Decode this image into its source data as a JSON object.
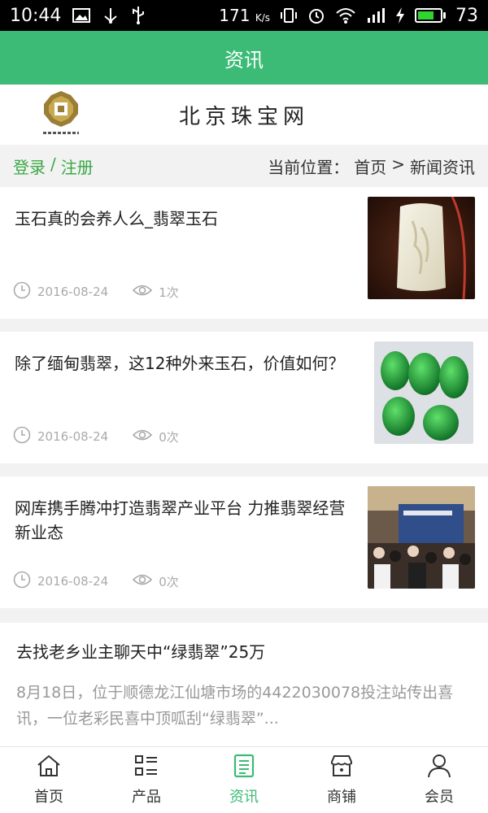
{
  "status_bar": {
    "time": "10:44",
    "net_speed": "171",
    "net_unit": "K/s",
    "battery": "73",
    "battery_fraction": 0.73,
    "icons": [
      "image-icon",
      "usb-icon",
      "vibrate-icon",
      "alarm-icon",
      "wifi-icon",
      "signal-icon",
      "charging-icon",
      "battery-icon"
    ]
  },
  "appbar": {
    "title": "资讯"
  },
  "logo": {
    "site_name": "北京珠宝网"
  },
  "breadcrumb": {
    "login": "登录",
    "separator": "/",
    "register": "注册",
    "current_label": "当前位置：",
    "home": "首页",
    "arrow": ">",
    "section": "新闻资讯"
  },
  "news": [
    {
      "title": "玉石真的会养人么_翡翠玉石",
      "date": "2016-08-24",
      "views": "1次",
      "thumb": "white-jade-pendant"
    },
    {
      "title": "除了缅甸翡翠，这12种外来玉石，价值如何？",
      "date": "2016-08-24",
      "views": "0次",
      "thumb": "green-jade-carvings"
    },
    {
      "title": "网库携手腾冲打造翡翠产业平台 力推翡翠经营新业态",
      "date": "2016-08-24",
      "views": "0次",
      "thumb": "conference-photo"
    }
  ],
  "text_news": {
    "title": "去找老乡业主聊天中“绿翡翠”25万",
    "summary": "8月18日，位于顺德龙江仙塘市场的4422030078投注站传出喜讯，一位老彩民喜中顶呱刮“绿翡翠”..."
  },
  "bottom_nav": [
    {
      "label": "首页",
      "icon": "home-icon",
      "active": false
    },
    {
      "label": "产品",
      "icon": "list-icon",
      "active": false
    },
    {
      "label": "资讯",
      "icon": "news-icon",
      "active": true
    },
    {
      "label": "商铺",
      "icon": "shop-icon",
      "active": false
    },
    {
      "label": "会员",
      "icon": "user-icon",
      "active": false
    }
  ],
  "colors": {
    "accent": "#3cbb76",
    "login": "#3aa845",
    "meta": "#aaaaaa"
  }
}
